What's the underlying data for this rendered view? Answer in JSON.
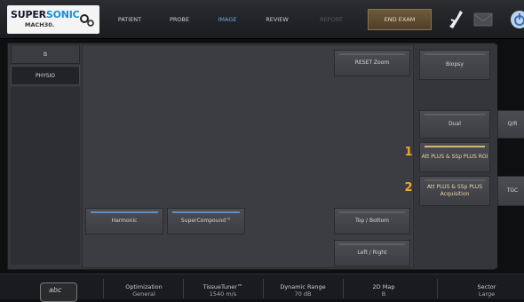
{
  "logo": {
    "brand_super": "SUPER",
    "brand_sonic": "SONIC",
    "model": "MACH30."
  },
  "nav": {
    "patient": "PATIENT",
    "probe": "PROBE",
    "image": "IMAGE",
    "review": "REVIEW",
    "report": "REPORT",
    "end_exam": "END EXAM"
  },
  "tabs": {
    "b": "B",
    "physio": "PHYSIO"
  },
  "content": {
    "reset_zoom": "RESET Zoom",
    "harmonic": "Harmonic",
    "supercompound": "SuperCompound™",
    "top_bottom": "Top / Bottom",
    "left_right": "Left / Right"
  },
  "right": {
    "biopsy": "Biopsy",
    "dual": "Dual",
    "att_roi": "Att PLUS & SSp PLUS ROI",
    "att_acq": "Att PLUS & SSp PLUS Acquisition",
    "num1": "1",
    "num2": "2",
    "qr": "Q/R",
    "tgc": "TGC"
  },
  "bottom": {
    "abc": "abc",
    "optimization_label": "Optimization",
    "optimization_value": "General",
    "tissuetuner_label": "TissueTuner™",
    "tissuetuner_value": "1540 m/s",
    "dynamic_label": "Dynamic Range",
    "dynamic_value": "70 dB",
    "map_label": "2D Map",
    "map_value": "B",
    "sector_label": "Sector",
    "sector_value": "Large"
  },
  "colors": {
    "accent_blue": "#6fa8dc",
    "end_exam": "#5e4c33",
    "highlight_gold": "#f2a72b"
  }
}
